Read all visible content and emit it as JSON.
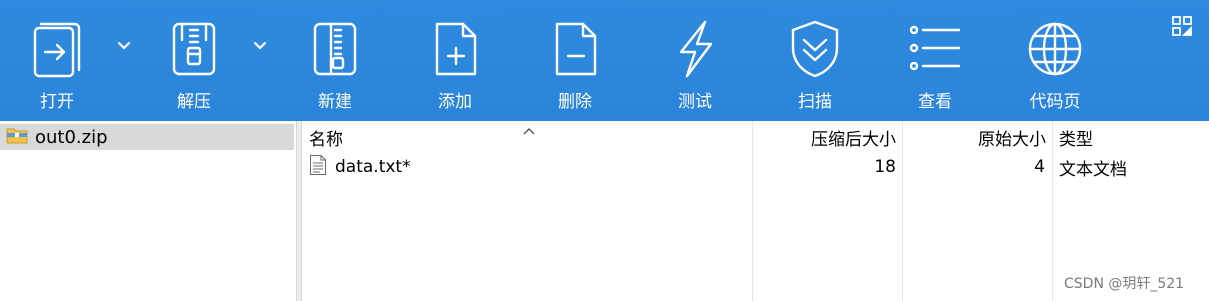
{
  "toolbar": {
    "buttons": [
      {
        "label": "打开",
        "icon": "open-icon"
      },
      {
        "label": "解压",
        "icon": "extract-icon"
      },
      {
        "label": "新建",
        "icon": "new-archive-icon"
      },
      {
        "label": "添加",
        "icon": "add-file-icon"
      },
      {
        "label": "删除",
        "icon": "delete-file-icon"
      },
      {
        "label": "测试",
        "icon": "test-lightning-icon"
      },
      {
        "label": "扫描",
        "icon": "scan-shield-icon"
      },
      {
        "label": "查看",
        "icon": "view-list-icon"
      },
      {
        "label": "代码页",
        "icon": "codepage-globe-icon"
      }
    ],
    "accent_color": "#2d88de"
  },
  "tree": {
    "items": [
      {
        "name": "out0.zip",
        "icon": "zip-folder-icon"
      }
    ]
  },
  "list": {
    "columns": {
      "name": "名称",
      "compressed_size": "压缩后大小",
      "original_size": "原始大小",
      "type": "类型"
    },
    "sort_indicator": "^",
    "rows": [
      {
        "name": "data.txt*",
        "compressed_size": "18",
        "original_size": "4",
        "type": "文本文档",
        "icon": "text-file-icon"
      }
    ]
  },
  "watermark": "CSDN @玥轩_521"
}
